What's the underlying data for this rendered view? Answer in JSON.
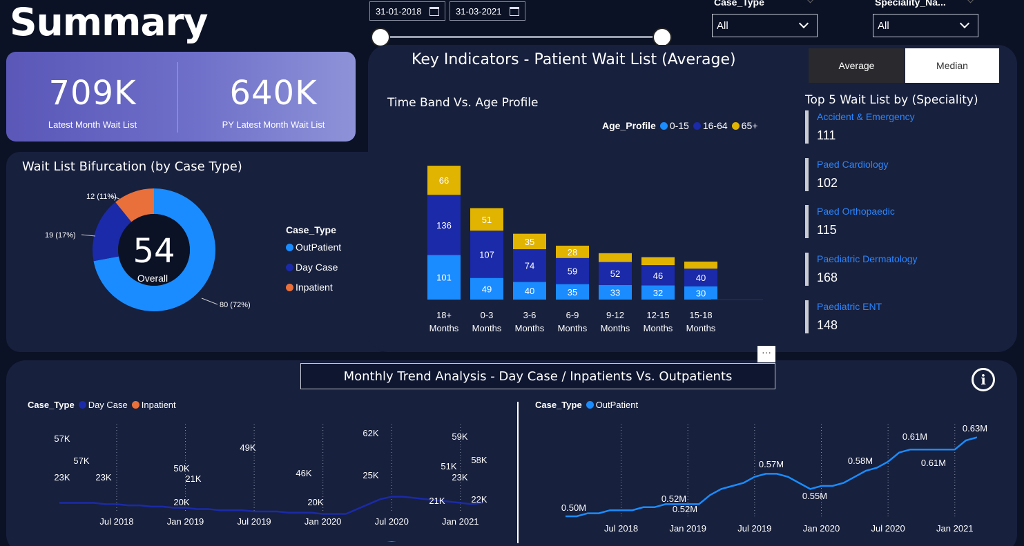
{
  "title": "Summary",
  "date_range": {
    "start": "31-01-2018",
    "end": "31-03-2021"
  },
  "filters": {
    "case_type": {
      "label": "Case_Type",
      "value": "All"
    },
    "speciality": {
      "label": "Speciality_Na...",
      "value": "All"
    }
  },
  "kpis": [
    {
      "value": "709K",
      "label": "Latest Month Wait List"
    },
    {
      "value": "640K",
      "label": "PY Latest Month Wait List"
    }
  ],
  "bifurcation": {
    "title": "Wait List Bifurcation (by Case Type)",
    "center_value": "54",
    "center_label": "Overall",
    "legend_title": "Case_Type",
    "slices": [
      {
        "name": "OutPatient",
        "value": 80,
        "label": "80 (72%)",
        "color": "#1a8cff"
      },
      {
        "name": "Day Case",
        "value": 19,
        "label": "19 (17%)",
        "color": "#1b2aa8"
      },
      {
        "name": "Inpatient",
        "value": 12,
        "label": "12 (11%)",
        "color": "#e9703a"
      }
    ]
  },
  "key_indicators": {
    "title": "Key Indicators - Patient Wait List (Average)",
    "toggle": {
      "average": "Average",
      "median": "Median",
      "active": "Average"
    }
  },
  "time_band": {
    "title": "Time Band Vs. Age Profile",
    "legend_title": "Age_Profile",
    "legend": [
      "0-15",
      "16-64",
      "65+"
    ]
  },
  "top5": {
    "title": "Top 5 Wait List by (Speciality)",
    "items": [
      {
        "name": "Accident & Emergency",
        "value": "111"
      },
      {
        "name": "Paed Cardiology",
        "value": "102"
      },
      {
        "name": "Paed Orthopaedic",
        "value": "115"
      },
      {
        "name": "Paediatric Dermatology",
        "value": "168"
      },
      {
        "name": "Paediatric ENT",
        "value": "148"
      }
    ]
  },
  "trend": {
    "title": "Monthly Trend Analysis - Day Case / Inpatients Vs. Outpatients",
    "more_label": "···",
    "info_label": "i",
    "left_legend": {
      "title": "Case_Type",
      "items": [
        "Day Case",
        "Inpatient"
      ]
    },
    "right_legend": {
      "title": "Case_Type",
      "items": [
        "OutPatient"
      ]
    }
  },
  "colors": {
    "c0_15": "#1a8cff",
    "c16_64": "#1b2aa8",
    "c65": "#e0b400",
    "inpatient": "#e9703a",
    "outpatient": "#1a8cff",
    "daycase": "#1b2aa8"
  },
  "chart_data": [
    {
      "type": "pie",
      "title": "Wait List Bifurcation (by Case Type)",
      "categories": [
        "OutPatient",
        "Day Case",
        "Inpatient"
      ],
      "values": [
        80,
        19,
        12
      ]
    },
    {
      "type": "bar",
      "title": "Time Band Vs. Age Profile",
      "categories": [
        "18+ Months",
        "0-3 Months",
        "3-6 Months",
        "6-9 Months",
        "9-12 Months",
        "12-15 Months",
        "15-18 Months"
      ],
      "series": [
        {
          "name": "0-15",
          "values": [
            101,
            49,
            40,
            35,
            33,
            32,
            30
          ]
        },
        {
          "name": "16-64",
          "values": [
            136,
            107,
            74,
            59,
            52,
            46,
            40
          ]
        },
        {
          "name": "65+",
          "values": [
            66,
            51,
            35,
            28,
            20,
            18,
            16
          ]
        }
      ],
      "stacked": true
    },
    {
      "type": "line",
      "title": "Monthly Trend Analysis - Day Case / Inpatients",
      "x": [
        "Feb 2018",
        "Mar 2018",
        "Apr 2018",
        "May 2018",
        "Jun 2018",
        "Jul 2018",
        "Aug 2018",
        "Sep 2018",
        "Oct 2018",
        "Nov 2018",
        "Dec 2018",
        "Jan 2019",
        "Feb 2019",
        "Mar 2019",
        "Apr 2019",
        "May 2019",
        "Jun 2019",
        "Jul 2019",
        "Aug 2019",
        "Sep 2019",
        "Oct 2019",
        "Nov 2019",
        "Dec 2019",
        "Jan 2020",
        "Feb 2020",
        "Mar 2020",
        "Apr 2020",
        "May 2020",
        "Jun 2020",
        "Jul 2020",
        "Aug 2020",
        "Sep 2020",
        "Oct 2020",
        "Nov 2020",
        "Dec 2020",
        "Jan 2021",
        "Feb 2021",
        "Mar 2021"
      ],
      "x_ticks": [
        "Jul 2018",
        "Jan 2019",
        "Jul 2019",
        "Jan 2020",
        "Jul 2020",
        "Jan 2021"
      ],
      "series": [
        {
          "name": "Day Case",
          "values": [
            57,
            57,
            57,
            57,
            56,
            56,
            55,
            55,
            54,
            54,
            53,
            53,
            52,
            52,
            51,
            51,
            51,
            50,
            50,
            50,
            49,
            49,
            49,
            48,
            48,
            48,
            52,
            56,
            60,
            62,
            62,
            61,
            60,
            59,
            58,
            57,
            56,
            57
          ]
        },
        {
          "name": "Inpatient",
          "values": [
            23,
            23,
            23,
            23,
            22,
            22,
            22,
            22,
            21,
            21,
            21,
            20,
            20,
            20,
            20,
            20,
            20,
            20,
            20,
            20,
            20,
            20,
            20,
            20,
            20,
            20,
            21,
            23,
            24,
            25,
            24,
            23,
            23,
            22,
            22,
            22,
            22,
            22
          ]
        }
      ],
      "data_labels": [
        {
          "text": "57K"
        },
        {
          "text": "57K"
        },
        {
          "text": "23K"
        },
        {
          "text": "23K"
        },
        {
          "text": "50K"
        },
        {
          "text": "21K"
        },
        {
          "text": "20K"
        },
        {
          "text": "49K"
        },
        {
          "text": "46K"
        },
        {
          "text": "20K"
        },
        {
          "text": "62K"
        },
        {
          "text": "25K"
        },
        {
          "text": "59K"
        },
        {
          "text": "51K"
        },
        {
          "text": "58K"
        },
        {
          "text": "23K"
        },
        {
          "text": "21K"
        },
        {
          "text": "22K"
        }
      ]
    },
    {
      "type": "line",
      "title": "Monthly Trend Analysis - Outpatients",
      "x": [
        "Feb 2018",
        "Mar 2018",
        "Apr 2018",
        "May 2018",
        "Jun 2018",
        "Jul 2018",
        "Aug 2018",
        "Sep 2018",
        "Oct 2018",
        "Nov 2018",
        "Dec 2018",
        "Jan 2019",
        "Feb 2019",
        "Mar 2019",
        "Apr 2019",
        "May 2019",
        "Jun 2019",
        "Jul 2019",
        "Aug 2019",
        "Sep 2019",
        "Oct 2019",
        "Nov 2019",
        "Dec 2019",
        "Jan 2020",
        "Feb 2020",
        "Mar 2020",
        "Apr 2020",
        "May 2020",
        "Jun 2020",
        "Jul 2020",
        "Aug 2020",
        "Sep 2020",
        "Oct 2020",
        "Nov 2020",
        "Dec 2020",
        "Jan 2021",
        "Feb 2021",
        "Mar 2021"
      ],
      "x_ticks": [
        "Jul 2018",
        "Jan 2019",
        "Jul 2019",
        "Jan 2020",
        "Jul 2020",
        "Jan 2021"
      ],
      "series": [
        {
          "name": "OutPatient",
          "values": [
            0.5,
            0.5,
            0.505,
            0.505,
            0.51,
            0.51,
            0.51,
            0.515,
            0.515,
            0.52,
            0.52,
            0.52,
            0.52,
            0.535,
            0.545,
            0.55,
            0.555,
            0.565,
            0.57,
            0.57,
            0.565,
            0.555,
            0.545,
            0.55,
            0.55,
            0.555,
            0.565,
            0.575,
            0.58,
            0.59,
            0.605,
            0.61,
            0.61,
            0.61,
            0.61,
            0.61,
            0.625,
            0.63
          ]
        }
      ],
      "data_labels": [
        {
          "text": "0.50M"
        },
        {
          "text": "0.52M"
        },
        {
          "text": "0.52M"
        },
        {
          "text": "0.57M"
        },
        {
          "text": "0.55M"
        },
        {
          "text": "0.58M"
        },
        {
          "text": "0.61M"
        },
        {
          "text": "0.61M"
        },
        {
          "text": "0.63M"
        }
      ]
    }
  ]
}
